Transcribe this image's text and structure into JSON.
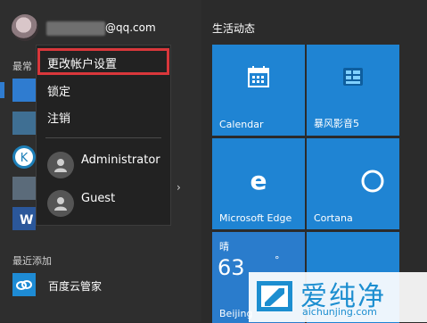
{
  "account": {
    "email_suffix": "@qq.com"
  },
  "left_pane": {
    "frequent_label": "最常",
    "recent_label": "最近添加",
    "recent_items": [
      {
        "label": "百度云管家",
        "icon": "cloud-manager-icon"
      }
    ]
  },
  "user_menu": {
    "items": [
      {
        "label": "更改帐户设置"
      },
      {
        "label": "锁定"
      },
      {
        "label": "注销"
      }
    ],
    "users": [
      {
        "name": "Administrator",
        "icon": "user-avatar-icon"
      },
      {
        "name": "Guest",
        "icon": "user-avatar-icon"
      }
    ],
    "highlight_color": "#d9373b"
  },
  "tiles": {
    "group_title": "生活动态",
    "items": [
      {
        "label": "Calendar",
        "icon": "calendar-icon",
        "color": "#1f84d3"
      },
      {
        "label": "暴风影音5",
        "icon": "storm-player-icon",
        "color": "#1f84d3"
      },
      {
        "label": "Microsoft Edge",
        "icon": "edge-icon",
        "color": "#1f84d3"
      },
      {
        "label": "Cortana",
        "icon": "cortana-icon",
        "color": "#1f84d3"
      }
    ],
    "weather": {
      "condition": "晴",
      "temp": "63",
      "degree": "°",
      "city": "Beijing"
    }
  },
  "watermark": {
    "title": "爱纯净",
    "url": "aichunjing.com",
    "color": "#1c8ed0"
  }
}
